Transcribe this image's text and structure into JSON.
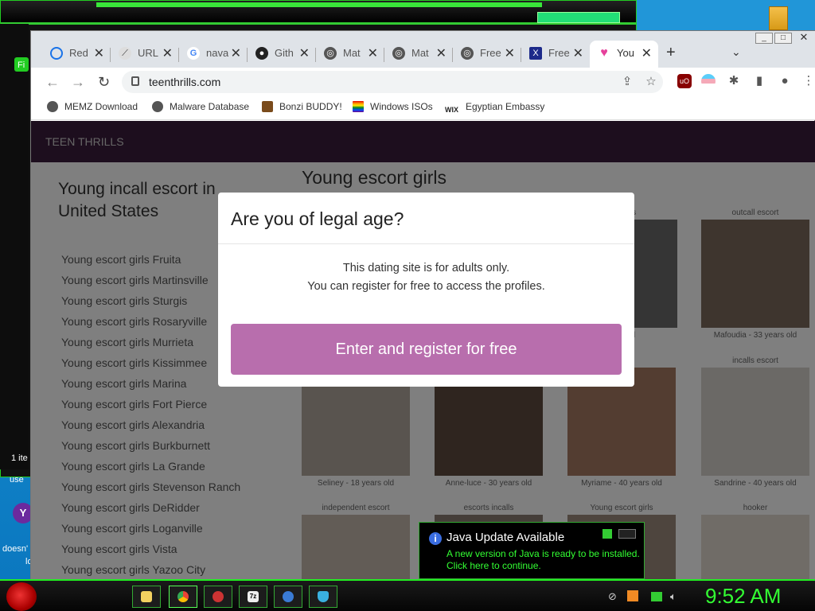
{
  "browser": {
    "tabs": [
      {
        "label": "Red",
        "icon": "loading-icon"
      },
      {
        "label": "URL",
        "icon": "url-icon"
      },
      {
        "label": "nava",
        "icon": "google-icon"
      },
      {
        "label": "Gith",
        "icon": "github-icon"
      },
      {
        "label": "Mat",
        "icon": "globe-icon"
      },
      {
        "label": "Mat",
        "icon": "globe-icon"
      },
      {
        "label": "Free",
        "icon": "globe-icon"
      },
      {
        "label": "Free",
        "icon": "x-icon"
      },
      {
        "label": "You",
        "icon": "heart-icon"
      }
    ],
    "url": "teenthrills.com",
    "bookmarks": [
      "MEMZ Download",
      "Malware Database",
      "Bonzi BUDDY!",
      "Windows ISOs",
      "Egyptian Embassy"
    ]
  },
  "site": {
    "logo": "TEEN THRILLS",
    "left_heading": "Young incall escort in United States",
    "right_heading": "Young escort girls",
    "links": [
      "Young escort girls Fruita",
      "Young escort girls Martinsville",
      "Young escort girls Sturgis",
      "Young escort girls Rosaryville",
      "Young escort girls Murrieta",
      "Young escort girls Kissimmee",
      "Young escort girls Marina",
      "Young escort girls Fort Pierce",
      "Young escort girls Alexandria",
      "Young escort girls Burkburnett",
      "Young escort girls La Grande",
      "Young escort girls Stevenson Ranch",
      "Young escort girls DeRidder",
      "Young escort girls Loganville",
      "Young escort girls Vista",
      "Young escort girls Yazoo City"
    ],
    "cards": [
      {
        "cap": "escorts",
        "sub": "ars old"
      },
      {
        "cap": "outcall escort",
        "sub": "Mafoudia - 33 years old"
      },
      {
        "cap": "",
        "sub": "Seliney - 18 years old"
      },
      {
        "cap": "",
        "sub": "Anne-luce - 30 years old"
      },
      {
        "cap": "cort",
        "sub": "Myriame - 40 years old"
      },
      {
        "cap": "incalls escort",
        "sub": "Sandrine - 40 years old"
      },
      {
        "cap": "independent escort",
        "sub": ""
      },
      {
        "cap": "escorts incalls",
        "sub": ""
      },
      {
        "cap": "Young escort girls",
        "sub": ""
      },
      {
        "cap": "hooker",
        "sub": ""
      }
    ]
  },
  "modal": {
    "title": "Are you of legal age?",
    "line1": "This dating site is for adults only.",
    "line2": "You can register for free to access the profiles.",
    "button": "Enter and register for free"
  },
  "java": {
    "title": "Java Update Available",
    "line1": "A new version of Java is ready to be installed.",
    "line2": "Click here to continue."
  },
  "desktop": {
    "labels": [
      "Fi",
      "1 ite",
      "use",
      "doesn'",
      "lo"
    ]
  },
  "taskbar": {
    "clock": "9:52 AM"
  },
  "colors": {
    "accent": "#b86ead",
    "site_header": "#3b1d3c",
    "java_text": "#33ff33"
  }
}
